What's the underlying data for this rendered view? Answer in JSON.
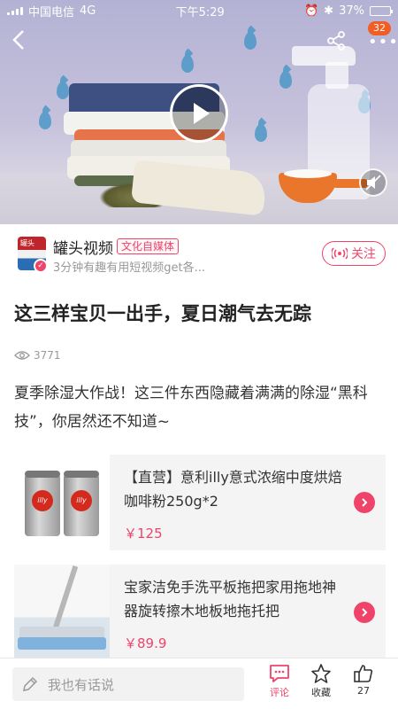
{
  "status_bar": {
    "carrier": "中国电信",
    "network": "4G",
    "time": "下午5:29",
    "battery": "37%",
    "battery_level": 0.37
  },
  "video": {
    "notification_count": "32",
    "icons": {
      "back": "back-arrow-icon",
      "share": "share-icon",
      "more": "more-icon",
      "play": "play-icon",
      "mute": "mute-icon"
    }
  },
  "author": {
    "name": "罐头视频",
    "tag": "文化自媒体",
    "description": "3分钟有趣有用短视频get各...",
    "follow_label": "关注",
    "avatar_text": "罐头"
  },
  "article": {
    "title": "这三样宝贝一出手，夏日潮气去无踪",
    "views": "3771",
    "description": "夏季除湿大作战！这三件东西隐藏着满满的除湿“黑科技”，你居然还不知道~"
  },
  "products": [
    {
      "title": "【直营】意利illy意式浓缩中度烘焙咖啡粉250g*2",
      "price": "￥125"
    },
    {
      "title": "宝家洁免手洗平板拖把家用拖地神器旋转擦木地板地拖托把",
      "price": "￥89.9"
    }
  ],
  "bottom_bar": {
    "comment_placeholder": "我也有话说",
    "comment_label": "评论",
    "favorite_label": "收藏",
    "like_count": "27"
  },
  "colors": {
    "accent": "#f0436a",
    "badge": "#f25d23",
    "price": "#f0436a"
  }
}
